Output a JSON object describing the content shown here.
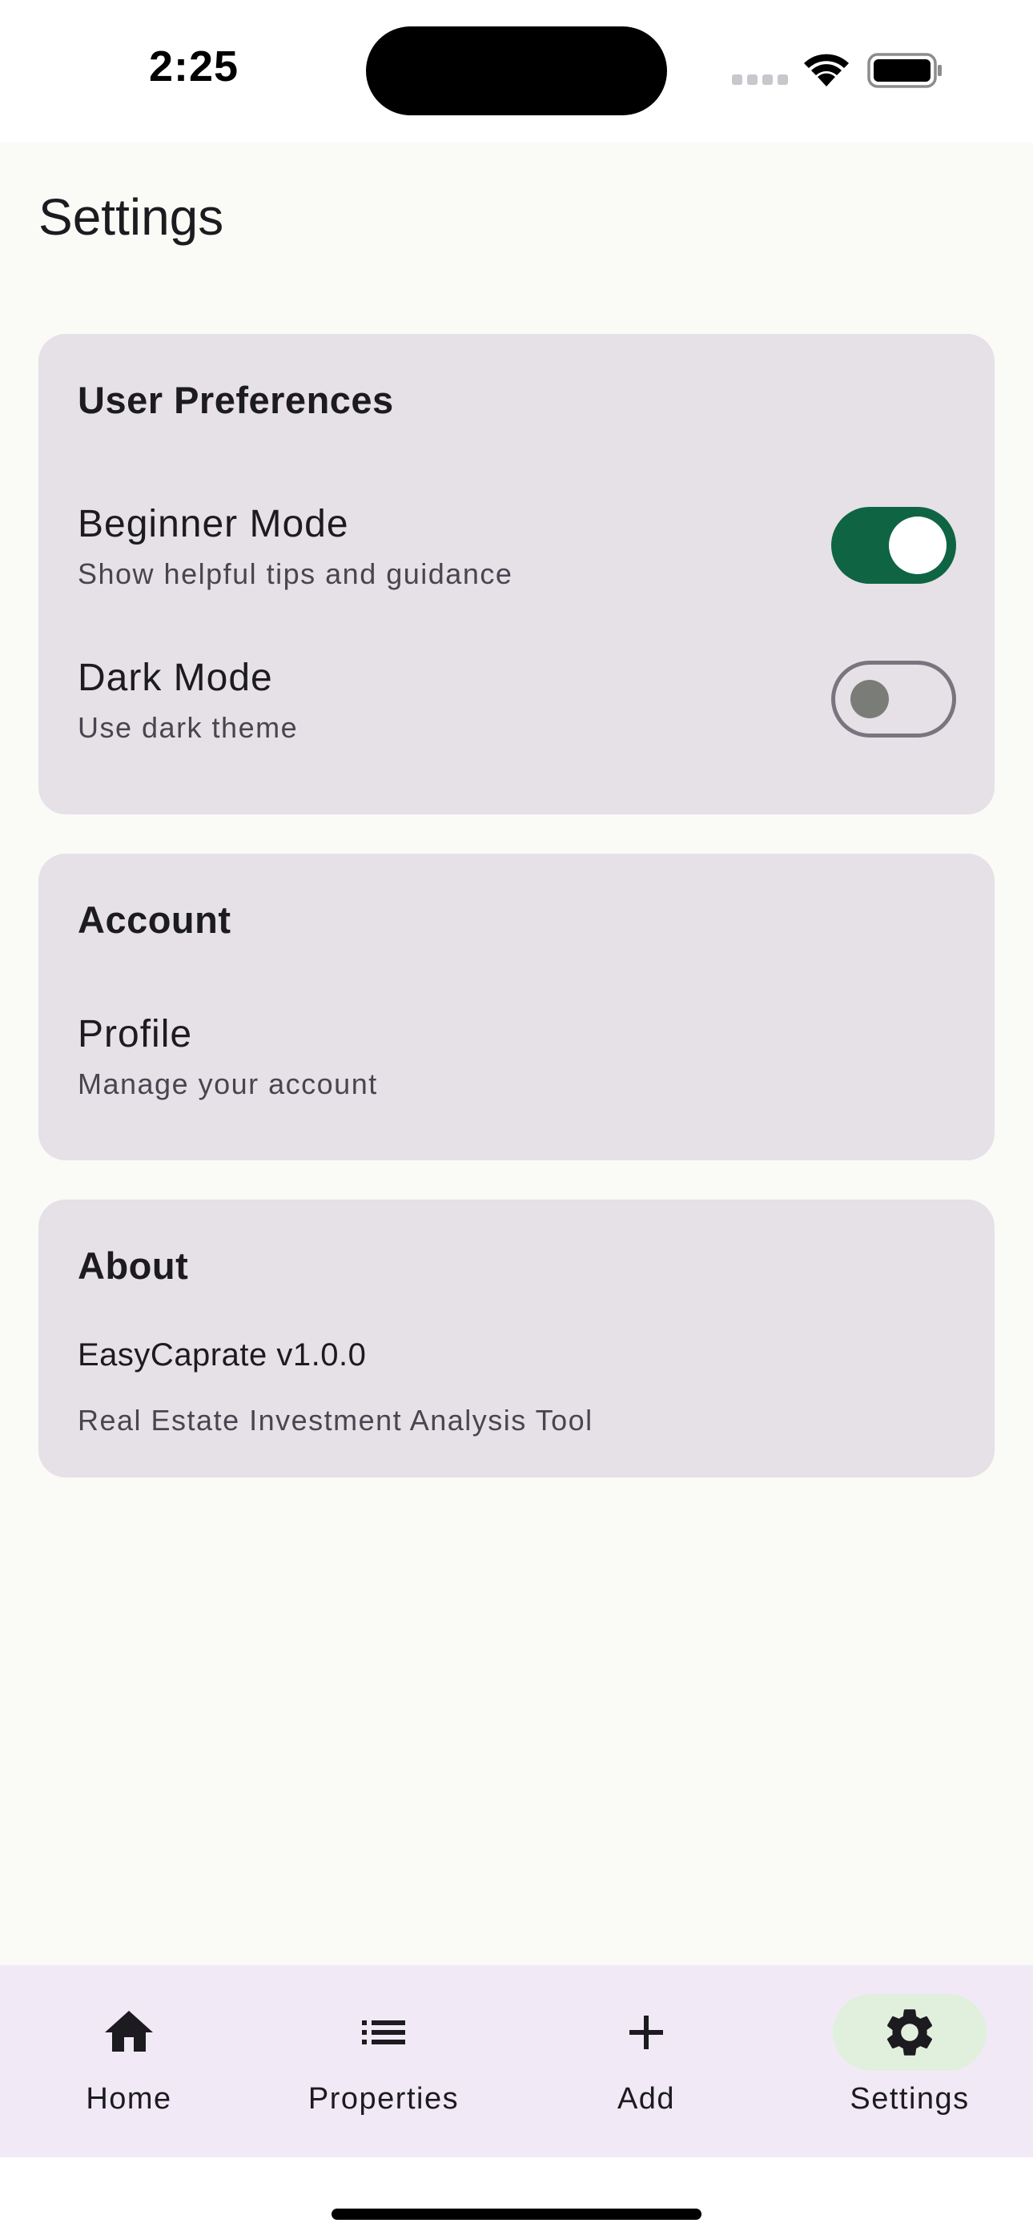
{
  "status_bar": {
    "time": "2:25"
  },
  "page": {
    "title": "Settings"
  },
  "sections": {
    "preferences": {
      "title": "User Preferences",
      "beginner_mode": {
        "label": "Beginner Mode",
        "description": "Show helpful tips and guidance",
        "enabled": true
      },
      "dark_mode": {
        "label": "Dark Mode",
        "description": "Use dark theme",
        "enabled": false
      }
    },
    "account": {
      "title": "Account",
      "profile": {
        "label": "Profile",
        "description": "Manage your account"
      }
    },
    "about": {
      "title": "About",
      "version": "EasyCaprate v1.0.0",
      "description": "Real Estate Investment Analysis Tool"
    }
  },
  "bottom_nav": {
    "items": [
      {
        "label": "Home",
        "icon": "home-icon",
        "active": false
      },
      {
        "label": "Properties",
        "icon": "list-icon",
        "active": false
      },
      {
        "label": "Add",
        "icon": "plus-icon",
        "active": false
      },
      {
        "label": "Settings",
        "icon": "gear-icon",
        "active": true
      }
    ]
  },
  "colors": {
    "accent": "#0f6443",
    "card_bg": "#e6e0e7",
    "nav_bg": "#f1eaf6",
    "active_pill": "#e0f0dd"
  }
}
